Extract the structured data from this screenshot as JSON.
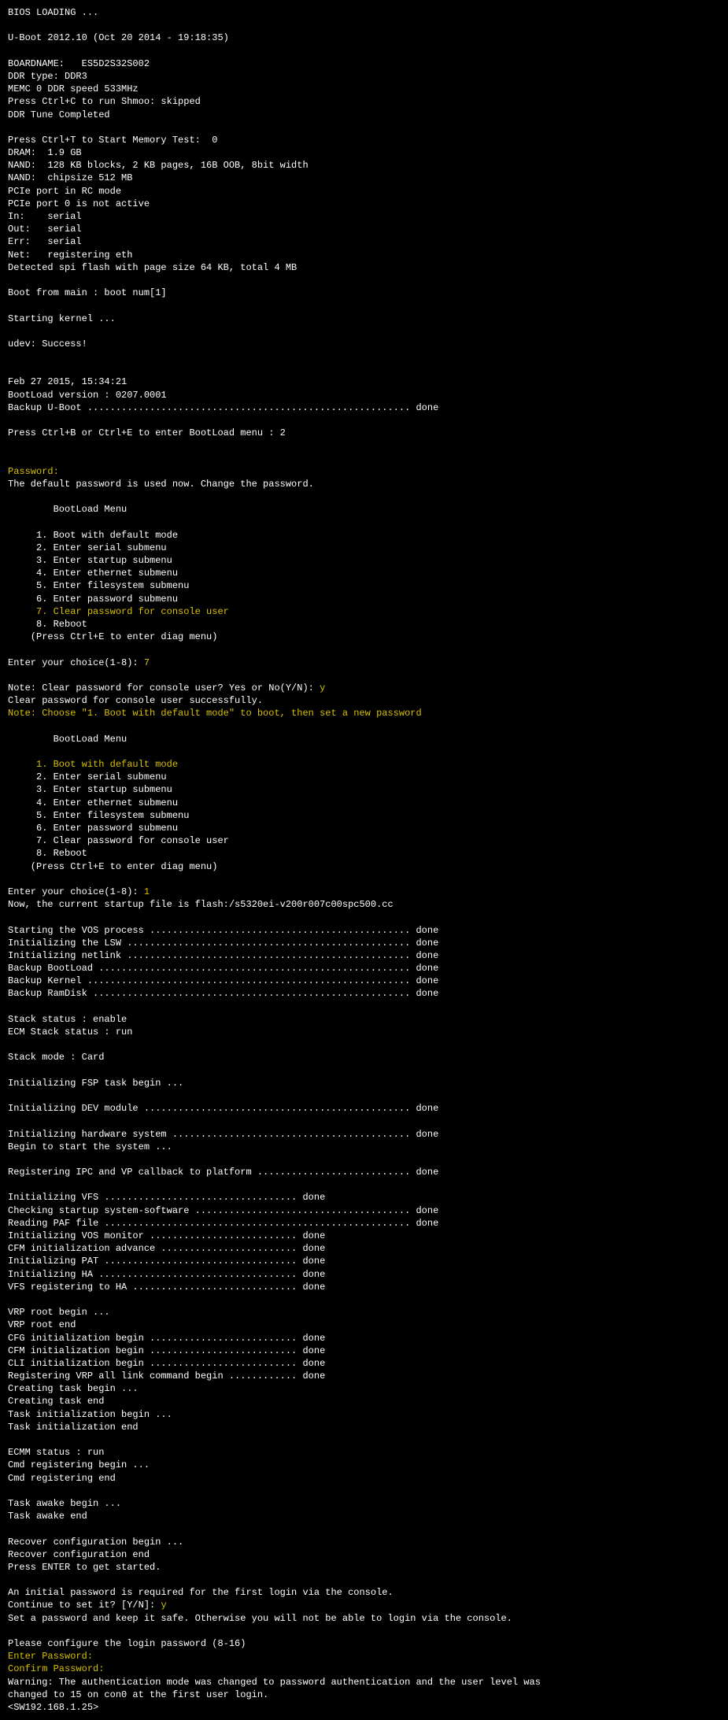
{
  "lines": [
    {
      "text": "BIOS LOADING ...",
      "cls": "w"
    },
    {
      "text": "",
      "cls": "w"
    },
    {
      "text": "U-Boot 2012.10 (Oct 20 2014 - 19:18:35)",
      "cls": "w"
    },
    {
      "text": "",
      "cls": "w"
    },
    {
      "text": "BOARDNAME:   ES5D2S32S002",
      "cls": "w"
    },
    {
      "text": "DDR type: DDR3",
      "cls": "w"
    },
    {
      "text": "MEMC 0 DDR speed 533MHz",
      "cls": "w"
    },
    {
      "text": "Press Ctrl+C to run Shmoo: skipped",
      "cls": "w"
    },
    {
      "text": "DDR Tune Completed",
      "cls": "w"
    },
    {
      "text": "",
      "cls": "w"
    },
    {
      "text": "Press Ctrl+T to Start Memory Test:  0",
      "cls": "w"
    },
    {
      "text": "DRAM:  1.9 GB",
      "cls": "w"
    },
    {
      "text": "NAND:  128 KB blocks, 2 KB pages, 16B OOB, 8bit width",
      "cls": "w"
    },
    {
      "text": "NAND:  chipsize 512 MB",
      "cls": "w"
    },
    {
      "text": "PCIe port in RC mode",
      "cls": "w"
    },
    {
      "text": "PCIe port 0 is not active",
      "cls": "w"
    },
    {
      "text": "In:    serial",
      "cls": "w"
    },
    {
      "text": "Out:   serial",
      "cls": "w"
    },
    {
      "text": "Err:   serial",
      "cls": "w"
    },
    {
      "text": "Net:   registering eth",
      "cls": "w"
    },
    {
      "text": "Detected spi flash with page size 64 KB, total 4 MB",
      "cls": "w"
    },
    {
      "text": "",
      "cls": "w"
    },
    {
      "text": "Boot from main : boot num[1]",
      "cls": "w"
    },
    {
      "text": "",
      "cls": "w"
    },
    {
      "text": "Starting kernel ...",
      "cls": "w"
    },
    {
      "text": "",
      "cls": "w"
    },
    {
      "text": "udev: Success!",
      "cls": "w"
    },
    {
      "text": "",
      "cls": "w"
    },
    {
      "text": "",
      "cls": "w"
    },
    {
      "text": "Feb 27 2015, 15:34:21",
      "cls": "w"
    },
    {
      "text": "BootLoad version : 0207.0001",
      "cls": "w"
    },
    {
      "text": "Backup U-Boot ......................................................... done",
      "cls": "w"
    },
    {
      "text": "",
      "cls": "w"
    },
    {
      "text": "Press Ctrl+B or Ctrl+E to enter BootLoad menu : 2",
      "cls": "w"
    },
    {
      "text": "",
      "cls": "w"
    },
    {
      "text": "",
      "cls": "w"
    },
    {
      "text": "Password:",
      "cls": "y"
    },
    {
      "text": "The default password is used now. Change the password.",
      "cls": "w"
    },
    {
      "text": "",
      "cls": "w"
    },
    {
      "text": "        BootLoad Menu",
      "cls": "w"
    },
    {
      "text": "",
      "cls": "w"
    },
    {
      "text": "     1. Boot with default mode",
      "cls": "w"
    },
    {
      "text": "     2. Enter serial submenu",
      "cls": "w"
    },
    {
      "text": "     3. Enter startup submenu",
      "cls": "w"
    },
    {
      "text": "     4. Enter ethernet submenu",
      "cls": "w"
    },
    {
      "text": "     5. Enter filesystem submenu",
      "cls": "w"
    },
    {
      "text": "     6. Enter password submenu",
      "cls": "w"
    },
    {
      "text": "     7. Clear password for console user",
      "cls": "y"
    },
    {
      "text": "     8. Reboot",
      "cls": "w"
    },
    {
      "text": "    (Press Ctrl+E to enter diag menu)",
      "cls": "w"
    },
    {
      "text": "",
      "cls": "w"
    },
    {
      "spans": [
        {
          "text": "Enter your choice(1-8): ",
          "cls": "w"
        },
        {
          "text": "7",
          "cls": "y"
        }
      ]
    },
    {
      "text": "",
      "cls": "w"
    },
    {
      "spans": [
        {
          "text": "Note: Clear password for console user? Yes or No(Y/N): ",
          "cls": "w"
        },
        {
          "text": "y",
          "cls": "y"
        }
      ]
    },
    {
      "text": "Clear password for console user successfully.",
      "cls": "w"
    },
    {
      "text": "Note: Choose \"1. Boot with default mode\" to boot, then set a new password",
      "cls": "y"
    },
    {
      "text": "",
      "cls": "w"
    },
    {
      "text": "        BootLoad Menu",
      "cls": "w"
    },
    {
      "text": "",
      "cls": "w"
    },
    {
      "text": "     1. Boot with default mode",
      "cls": "y"
    },
    {
      "text": "     2. Enter serial submenu",
      "cls": "w"
    },
    {
      "text": "     3. Enter startup submenu",
      "cls": "w"
    },
    {
      "text": "     4. Enter ethernet submenu",
      "cls": "w"
    },
    {
      "text": "     5. Enter filesystem submenu",
      "cls": "w"
    },
    {
      "text": "     6. Enter password submenu",
      "cls": "w"
    },
    {
      "text": "     7. Clear password for console user",
      "cls": "w"
    },
    {
      "text": "     8. Reboot",
      "cls": "w"
    },
    {
      "text": "    (Press Ctrl+E to enter diag menu)",
      "cls": "w"
    },
    {
      "text": "",
      "cls": "w"
    },
    {
      "spans": [
        {
          "text": "Enter your choice(1-8): ",
          "cls": "w"
        },
        {
          "text": "1",
          "cls": "y"
        }
      ]
    },
    {
      "text": "Now, the current startup file is flash:/s5320ei-v200r007c00spc500.cc",
      "cls": "w"
    },
    {
      "text": "",
      "cls": "w"
    },
    {
      "text": "Starting the VOS process .............................................. done",
      "cls": "w"
    },
    {
      "text": "Initializing the LSW .................................................. done",
      "cls": "w"
    },
    {
      "text": "Initializing netlink .................................................. done",
      "cls": "w"
    },
    {
      "text": "Backup BootLoad ....................................................... done",
      "cls": "w"
    },
    {
      "text": "Backup Kernel ......................................................... done",
      "cls": "w"
    },
    {
      "text": "Backup RamDisk ........................................................ done",
      "cls": "w"
    },
    {
      "text": "",
      "cls": "w"
    },
    {
      "text": "Stack status : enable",
      "cls": "w"
    },
    {
      "text": "ECM Stack status : run",
      "cls": "w"
    },
    {
      "text": "",
      "cls": "w"
    },
    {
      "text": "Stack mode : Card",
      "cls": "w"
    },
    {
      "text": "",
      "cls": "w"
    },
    {
      "text": "Initializing FSP task begin ...",
      "cls": "w"
    },
    {
      "text": "",
      "cls": "w"
    },
    {
      "text": "Initializing DEV module ............................................... done",
      "cls": "w"
    },
    {
      "text": "",
      "cls": "w"
    },
    {
      "text": "Initializing hardware system .......................................... done",
      "cls": "w"
    },
    {
      "text": "Begin to start the system ...",
      "cls": "w"
    },
    {
      "text": "",
      "cls": "w"
    },
    {
      "text": "Registering IPC and VP callback to platform ........................... done",
      "cls": "w"
    },
    {
      "text": "",
      "cls": "w"
    },
    {
      "text": "Initializing VFS .................................. done",
      "cls": "w"
    },
    {
      "text": "Checking startup system-software ...................................... done",
      "cls": "w"
    },
    {
      "text": "Reading PAF file ...................................................... done",
      "cls": "w"
    },
    {
      "text": "Initializing VOS monitor .......................... done",
      "cls": "w"
    },
    {
      "text": "CFM initialization advance ........................ done",
      "cls": "w"
    },
    {
      "text": "Initializing PAT .................................. done",
      "cls": "w"
    },
    {
      "text": "Initializing HA ................................... done",
      "cls": "w"
    },
    {
      "text": "VFS registering to HA ............................. done",
      "cls": "w"
    },
    {
      "text": "",
      "cls": "w"
    },
    {
      "text": "VRP root begin ...",
      "cls": "w"
    },
    {
      "text": "VRP root end",
      "cls": "w"
    },
    {
      "text": "CFG initialization begin .......................... done",
      "cls": "w"
    },
    {
      "text": "CFM initialization begin .......................... done",
      "cls": "w"
    },
    {
      "text": "CLI initialization begin .......................... done",
      "cls": "w"
    },
    {
      "text": "Registering VRP all link command begin ............ done",
      "cls": "w"
    },
    {
      "text": "Creating task begin ...",
      "cls": "w"
    },
    {
      "text": "Creating task end",
      "cls": "w"
    },
    {
      "text": "Task initialization begin ...",
      "cls": "w"
    },
    {
      "text": "Task initialization end",
      "cls": "w"
    },
    {
      "text": "",
      "cls": "w"
    },
    {
      "text": "ECMM status : run",
      "cls": "w"
    },
    {
      "text": "Cmd registering begin ...",
      "cls": "w"
    },
    {
      "text": "Cmd registering end",
      "cls": "w"
    },
    {
      "text": "",
      "cls": "w"
    },
    {
      "text": "Task awake begin ...",
      "cls": "w"
    },
    {
      "text": "Task awake end",
      "cls": "w"
    },
    {
      "text": "",
      "cls": "w"
    },
    {
      "text": "Recover configuration begin ...",
      "cls": "w"
    },
    {
      "text": "Recover configuration end",
      "cls": "w"
    },
    {
      "text": "Press ENTER to get started.",
      "cls": "w"
    },
    {
      "text": "",
      "cls": "w"
    },
    {
      "text": "An initial password is required for the first login via the console.",
      "cls": "w"
    },
    {
      "spans": [
        {
          "text": "Continue to set it? [Y/N]: ",
          "cls": "w"
        },
        {
          "text": "y",
          "cls": "y"
        }
      ]
    },
    {
      "text": "Set a password and keep it safe. Otherwise you will not be able to login via the console.",
      "cls": "w"
    },
    {
      "text": "",
      "cls": "w"
    },
    {
      "text": "Please configure the login password (8-16)",
      "cls": "w"
    },
    {
      "text": "Enter Password:",
      "cls": "y"
    },
    {
      "text": "Confirm Password:",
      "cls": "y"
    },
    {
      "text": "Warning: The authentication mode was changed to password authentication and the user level was",
      "cls": "w"
    },
    {
      "text": "changed to 15 on con0 at the first user login.",
      "cls": "w"
    },
    {
      "text": "<SW192.168.1.25>",
      "cls": "w"
    }
  ]
}
